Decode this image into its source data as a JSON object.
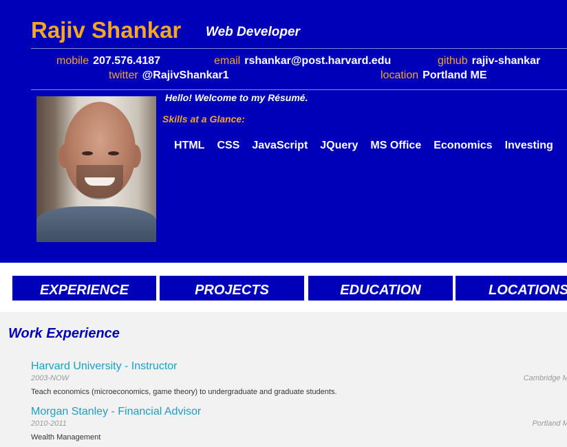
{
  "header": {
    "name": "Rajiv Shankar",
    "role": "Web Developer",
    "contacts": {
      "mobile": {
        "label": "mobile",
        "value": "207.576.4187"
      },
      "email": {
        "label": "email",
        "value": "rshankar@post.harvard.edu"
      },
      "github": {
        "label": "github",
        "value": "rajiv-shankar"
      },
      "twitter": {
        "label": "twitter",
        "value": "@RajivShankar1"
      },
      "location": {
        "label": "location",
        "value": "Portland ME"
      }
    },
    "welcome": "Hello! Welcome to my Résumé.",
    "skills_heading": "Skills at a Glance:",
    "skills": [
      "HTML",
      "CSS",
      "JavaScript",
      "JQuery",
      "MS Office",
      "Economics",
      "Investing"
    ]
  },
  "nav": [
    "EXPERIENCE",
    "PROJECTS",
    "EDUCATION",
    "LOCATIONS"
  ],
  "work": {
    "title": "Work Experience",
    "jobs": [
      {
        "title": "Harvard University - Instructor",
        "dates": "2003-NOW",
        "location": "Cambridge MA",
        "description": "Teach economics (microeconomics, game theory) to undergraduate and graduate students."
      },
      {
        "title": "Morgan Stanley - Financial Advisor",
        "dates": "2010-2011",
        "location": "Portland ME",
        "description": "Wealth Management"
      }
    ]
  },
  "colors": {
    "header_bg": "#0000b8",
    "accent": "#f5a623",
    "link": "#1a9ec4",
    "section_bg": "#f2f2f2"
  }
}
